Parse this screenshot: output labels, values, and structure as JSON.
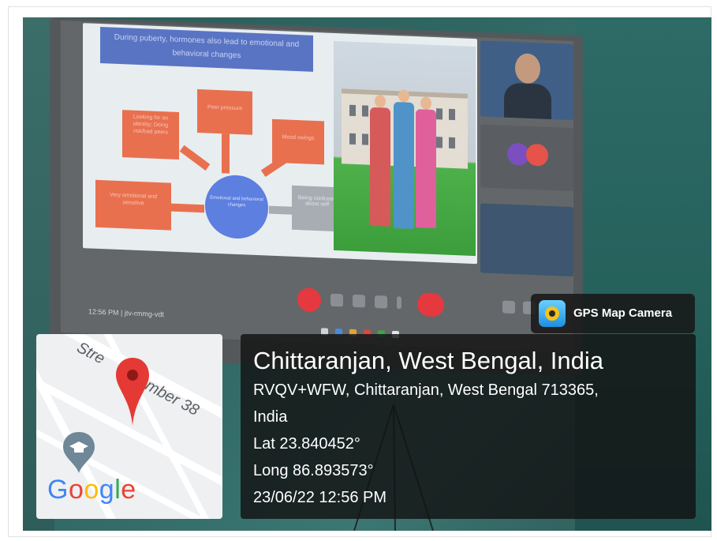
{
  "slide": {
    "title": "During puberty, hormones also lead to emotional and behavioral changes",
    "boxes": [
      "Looking for an identity; Doing risk/bad peers",
      "Peer pressure",
      "Mood swings",
      "Very emotional and sensitive",
      "Being confused about self"
    ],
    "center": "Emotional and behavioral changes"
  },
  "meeting": {
    "time": "12:56 PM",
    "code": "jtv-rmmg-vdt"
  },
  "map": {
    "street_label_1": "Stre",
    "street_label_2": "mber 38",
    "google_letters": [
      "G",
      "o",
      "o",
      "g",
      "l",
      "e"
    ]
  },
  "badge": {
    "label": "GPS Map Camera",
    "icon": "camera-pin-icon"
  },
  "location": {
    "title": "Chittaranjan, West Bengal, India",
    "address_line1": "RVQV+WFW, Chittaranjan, West Bengal 713365,",
    "address_line2": "India",
    "lat": "Lat 23.840452°",
    "long": "Long 86.893573°",
    "datetime": "23/06/22 12:56 PM"
  },
  "colors": {
    "pin_red": "#e53935",
    "overlay_bg": "#121212",
    "wall_teal": "#2e6a66"
  }
}
